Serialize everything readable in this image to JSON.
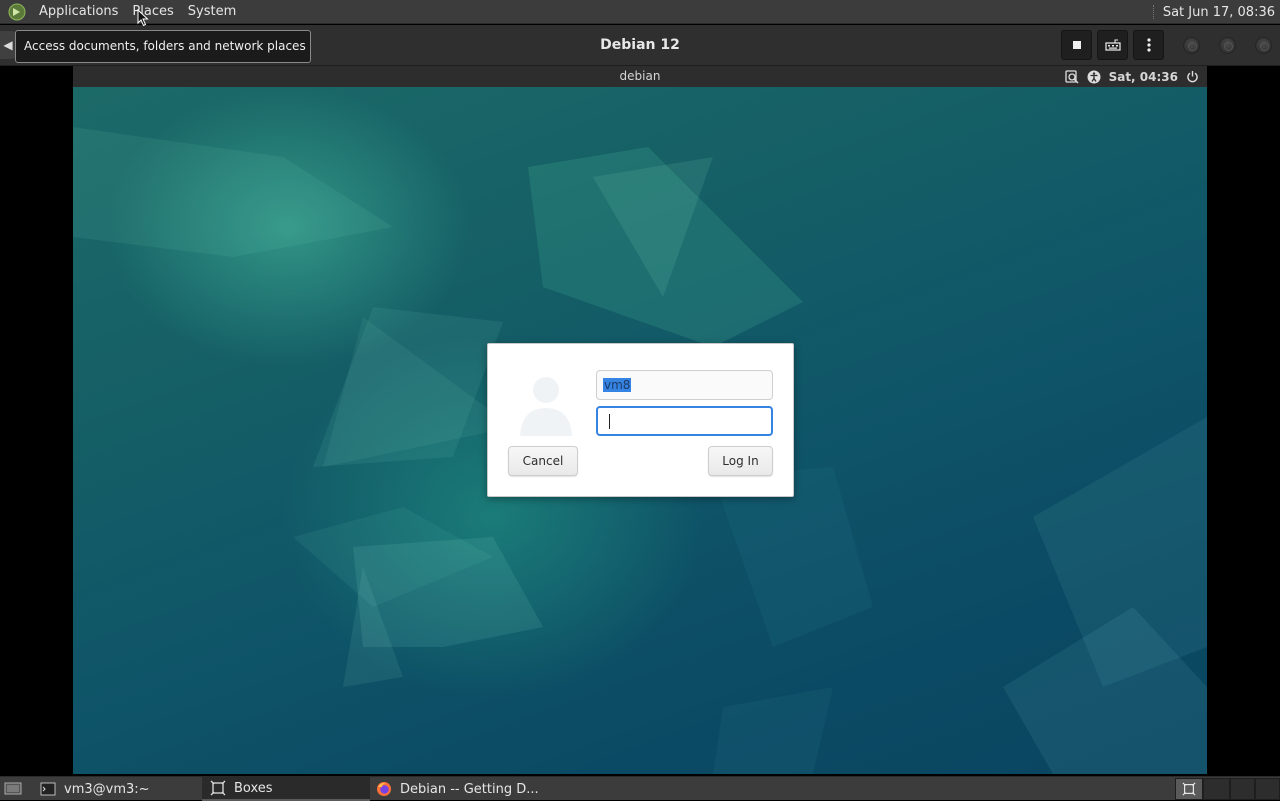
{
  "top_panel": {
    "menus": [
      "Applications",
      "Places",
      "System"
    ],
    "clock": "Sat Jun 17, 08:36"
  },
  "tooltip": {
    "text": "Access documents, folders and network places"
  },
  "boxes_window": {
    "title": "Debian 12"
  },
  "vm": {
    "hostname": "debian",
    "clock": "Sat, 04:36",
    "login": {
      "username": "vm8",
      "password": "",
      "cancel_label": "Cancel",
      "login_label": "Log In"
    }
  },
  "taskbar": {
    "tasks": [
      {
        "label": "vm3@vm3:~",
        "icon": "terminal-icon"
      },
      {
        "label": "Boxes",
        "icon": "boxes-icon"
      },
      {
        "label": "Debian -- Getting D...",
        "icon": "firefox-icon"
      }
    ]
  },
  "colors": {
    "accent": "#3584e4",
    "panel": "#3c3c3c"
  }
}
